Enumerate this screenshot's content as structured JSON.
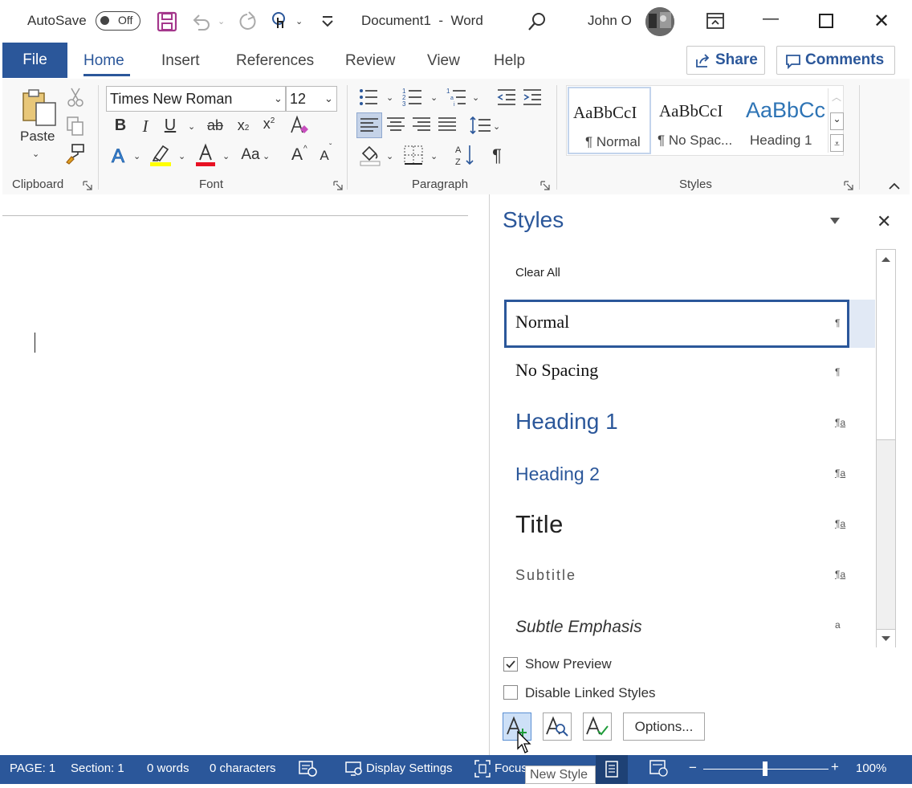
{
  "titlebar": {
    "autosave_label": "AutoSave",
    "autosave_state": "Off",
    "title": "Document1  -  Word",
    "user": "John O"
  },
  "menu": {
    "file": "File",
    "tabs": [
      "Home",
      "Insert",
      "References",
      "Review",
      "View",
      "Help"
    ],
    "share": "Share",
    "comments": "Comments"
  },
  "ribbon": {
    "clipboard": {
      "paste": "Paste",
      "label": "Clipboard"
    },
    "font": {
      "name": "Times New Roman",
      "size": "12",
      "label": "Font",
      "change_case": "Aa",
      "grow": "A",
      "shrink": "A"
    },
    "paragraph": {
      "label": "Paragraph"
    },
    "styles": {
      "label": "Styles",
      "gallery": [
        {
          "preview": "AaBbCcI",
          "name": "¶ Normal"
        },
        {
          "preview": "AaBbCcI",
          "name": "¶ No Spac..."
        },
        {
          "preview": "AaBbCc",
          "name": "Heading 1"
        }
      ]
    }
  },
  "styles_pane": {
    "title": "Styles",
    "clear_all": "Clear All",
    "items": [
      {
        "name": "Normal",
        "mark": "¶"
      },
      {
        "name": "No Spacing",
        "mark": "¶"
      },
      {
        "name": "Heading 1",
        "mark": "¶a"
      },
      {
        "name": "Heading 2",
        "mark": "¶a"
      },
      {
        "name": "Title",
        "mark": "¶a"
      },
      {
        "name": "Subtitle",
        "mark": "¶a"
      },
      {
        "name": "Subtle Emphasis",
        "mark": "a"
      }
    ],
    "show_preview": "Show Preview",
    "disable_linked": "Disable Linked Styles",
    "options": "Options...",
    "new_style_tooltip": "New Style"
  },
  "status": {
    "page": "PAGE: 1",
    "section": "Section: 1",
    "words": "0 words",
    "characters": "0 characters",
    "display_settings": "Display Settings",
    "focus": "Focus",
    "zoom": "100%"
  },
  "colors": {
    "accent": "#2b579a",
    "highlight": "#ffff00",
    "font_color": "#e81123"
  }
}
